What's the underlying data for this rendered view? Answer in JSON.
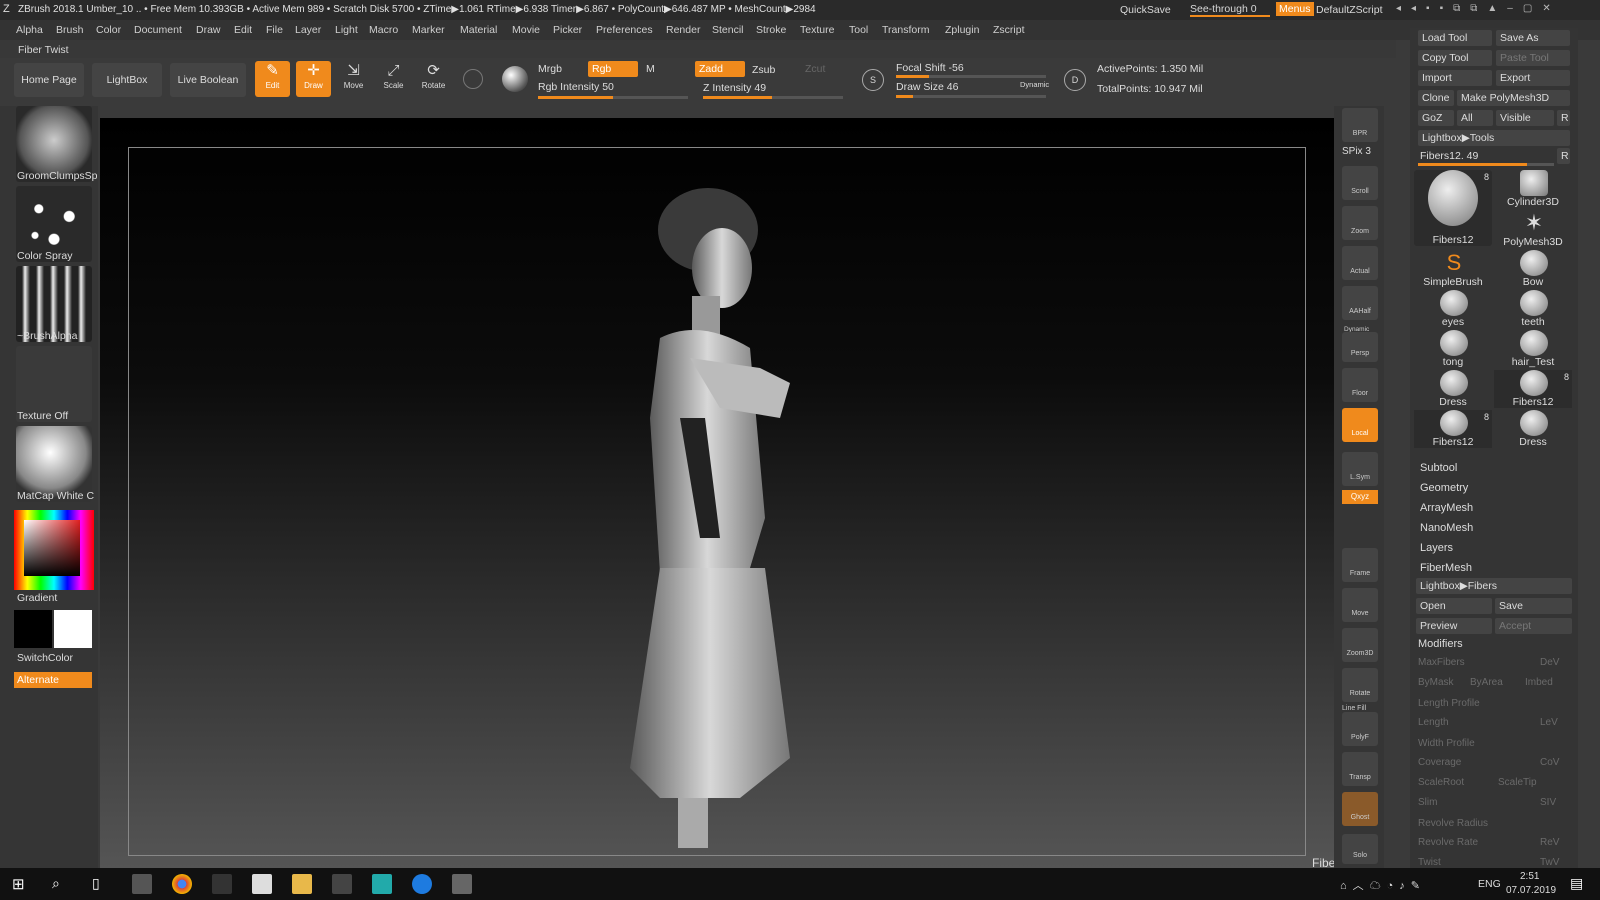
{
  "titlebar": {
    "text": "ZBrush 2018.1    Umber_10   .. • Free Mem 10.393GB • Active Mem 989 • Scratch Disk 5700 • ZTime▶1.061 RTime▶6.938 Timer▶6.867 • PolyCount▶646.487 MP • MeshCount▶2984",
    "quicksave": "QuickSave",
    "seethrough": "See-through  0",
    "menus": "Menus",
    "defaultzscript": "DefaultZScript"
  },
  "menubar": {
    "items": [
      "Alpha",
      "Brush",
      "Color",
      "Document",
      "Draw",
      "Edit",
      "File",
      "Layer",
      "Light",
      "Macro",
      "Marker",
      "Material",
      "Movie",
      "Picker",
      "Preferences",
      "Render",
      "Stencil",
      "Stroke",
      "Texture",
      "Tool",
      "Transform",
      "Zplugin",
      "Zscript"
    ]
  },
  "status": "Fiber Twist",
  "shelf": {
    "home": "Home Page",
    "lightbox": "LightBox",
    "liveboolean": "Live Boolean",
    "edit": "Edit",
    "draw": "Draw",
    "move": "Move",
    "scale": "Scale",
    "rotate": "Rotate",
    "mrgb": "Mrgb",
    "rgb": "Rgb",
    "m": "M",
    "rgb_intensity": "Rgb Intensity 50",
    "zadd": "Zadd",
    "zsub": "Zsub",
    "zcut": "Zcut",
    "z_intensity": "Z Intensity 49",
    "focal_shift": "Focal Shift -56",
    "draw_size": "Draw Size 46",
    "dynamic": "Dynamic",
    "active_points": "ActivePoints: 1.350 Mil",
    "total_points": "TotalPoints: 10.947 Mil",
    "rgb_intensity_value": 50,
    "z_intensity_value": 49,
    "focal_shift_value": -56,
    "draw_size_value": 46
  },
  "leftpanel": {
    "brush": "GroomClumpsSp",
    "stroke": "Color Spray",
    "alpha": "~BrushAlpha",
    "texture": "Texture Off",
    "material": "MatCap White C",
    "gradient": "Gradient",
    "switchcolor": "SwitchColor",
    "alternate": "Alternate"
  },
  "rightbar": {
    "items": [
      "BPR",
      "SPix 3",
      "Scroll",
      "Zoom",
      "Actual",
      "AAHalf",
      "Persp",
      "Floor",
      "Local",
      "L.Sym",
      "Qxyz",
      "Frame",
      "Move",
      "Zoom3D",
      "Rotate",
      "PolyF",
      "Transp",
      "Ghost",
      "Solo"
    ],
    "dynamic": "Dynamic",
    "linefill": "Line Fill"
  },
  "tool": {
    "load": "Load Tool",
    "saveas": "Save As",
    "copy": "Copy Tool",
    "paste": "Paste Tool",
    "import": "Import",
    "export": "Export",
    "clone": "Clone",
    "makepoly": "Make PolyMesh3D",
    "goz": "GoZ",
    "all": "All",
    "visible": "Visible",
    "r": "R",
    "lightbox_tools": "Lightbox▶Tools",
    "current": "Fibers12. 49",
    "items": [
      {
        "name": "Fibers12",
        "badge": "8"
      },
      {
        "name": "Cylinder3D",
        "badge": ""
      },
      {
        "name": "",
        "badge": ""
      },
      {
        "name": "PolyMesh3D",
        "badge": ""
      },
      {
        "name": "SimpleBrush",
        "badge": ""
      },
      {
        "name": "Bow",
        "badge": ""
      },
      {
        "name": "eyes",
        "badge": ""
      },
      {
        "name": "teeth",
        "badge": ""
      },
      {
        "name": "tong",
        "badge": ""
      },
      {
        "name": "hair_Test",
        "badge": ""
      },
      {
        "name": "Dress",
        "badge": ""
      },
      {
        "name": "Fibers12",
        "badge": "8"
      },
      {
        "name": "Fibers12",
        "badge": "8"
      },
      {
        "name": "Dress",
        "badge": ""
      }
    ],
    "sections": [
      "Subtool",
      "Geometry",
      "ArrayMesh",
      "NanoMesh",
      "Layers",
      "FiberMesh"
    ],
    "lightbox_fibers": "Lightbox▶Fibers",
    "open": "Open",
    "save": "Save",
    "preview": "Preview",
    "accept": "Accept",
    "modifiers": "Modifiers",
    "mods": [
      "MaxFibers",
      "DeV",
      "ByMask",
      "ByArea",
      "Imbed",
      "Length Profile",
      "Length",
      "LeV",
      "Width Profile",
      "Coverage",
      "CoV",
      "ScaleRoot",
      "ScaleTip",
      "Slim",
      "SIV",
      "Revolve Radius",
      "Revolve Rate",
      "ReV",
      "Twist",
      "TwV"
    ]
  },
  "viewport_label": "Fiber Twist",
  "taskbar": {
    "lang": "ENG",
    "time": "2:51",
    "date": "07.07.2019"
  },
  "colors": {
    "accent": "#f08a1c",
    "panel": "#353535"
  }
}
